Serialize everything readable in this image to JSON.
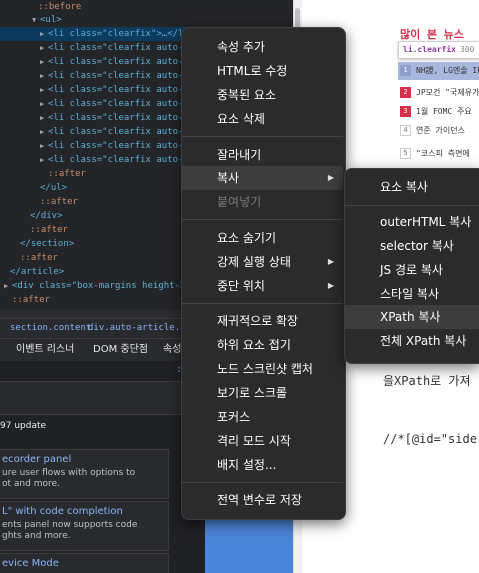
{
  "elements_panel": {
    "lines": [
      {
        "kind": "pseudo",
        "text": "::before"
      },
      {
        "kind": "tag",
        "text": "<ul>"
      },
      {
        "kind": "li",
        "text": "<li class=\"clearfix\">…</li>"
      },
      {
        "kind": "li",
        "text": "<li class=\"clearfix auto-"
      },
      {
        "kind": "li",
        "text": "<li class=\"clearfix auto-"
      },
      {
        "kind": "li",
        "text": "<li class=\"clearfix auto-"
      },
      {
        "kind": "li",
        "text": "<li class=\"clearfix auto-"
      },
      {
        "kind": "li",
        "text": "<li class=\"clearfix auto-"
      },
      {
        "kind": "li",
        "text": "<li class=\"clearfix auto-"
      },
      {
        "kind": "li",
        "text": "<li class=\"clearfix auto-"
      },
      {
        "kind": "li",
        "text": "<li class=\"clearfix auto-"
      },
      {
        "kind": "li",
        "text": "<li class=\"clearfix auto-"
      },
      {
        "kind": "pseudo",
        "text": "::after"
      },
      {
        "kind": "tag",
        "text": "</ul>"
      },
      {
        "kind": "pseudo",
        "text": "::after"
      },
      {
        "kind": "tag",
        "text": "</div>"
      },
      {
        "kind": "pseudo",
        "text": "::after"
      },
      {
        "kind": "tag",
        "text": "</section>"
      },
      {
        "kind": "pseudo",
        "text": "::after"
      },
      {
        "kind": "tag",
        "text": "</article>"
      },
      {
        "kind": "div",
        "text": "<div class=\"box-margins height-30"
      },
      {
        "kind": "pseudo",
        "text": "::after"
      }
    ]
  },
  "breadcrumb": {
    "item1": "section.content",
    "item2": "div.auto-article.auto-d"
  },
  "subtabs": {
    "event_listeners": "이벤트 리스너",
    "dom_breakpoints": "DOM 중단점",
    "properties": "속성"
  },
  "filter": {
    "hint": ":"
  },
  "drawer": {
    "update_title": "97 update",
    "cards": [
      {
        "title": "ecorder panel",
        "desc1": "ure user flows with options to",
        "desc2": "ot and more."
      },
      {
        "title": "L\" with code completion",
        "desc1": "ents panel now supports code",
        "desc2": "ghts and more."
      },
      {
        "title": "evice Mode",
        "desc1": "",
        "desc2": ""
      }
    ]
  },
  "webpage": {
    "most_viewed": "많이 본 뉴스",
    "tooltip_selector": "li.clearfix",
    "tooltip_size": "300 × 23",
    "news": [
      {
        "rank": "1",
        "title": "NH證, LG엔솔 IPO",
        "style": "red"
      },
      {
        "rank": "2",
        "title": "JP모건 \"국제유가",
        "style": "red"
      },
      {
        "rank": "3",
        "title": "1월 FOMC 주요",
        "style": "red"
      },
      {
        "rank": "4",
        "title": "연준 가이던스",
        "style": "gray"
      },
      {
        "rank": "5",
        "title": "\"코스피 측면에",
        "style": "gray"
      }
    ],
    "text1": "을XPath로 가져",
    "text2": "//*[@id=\"side-"
  },
  "context_menu": {
    "items": [
      {
        "label": "속성 추가"
      },
      {
        "label": "HTML로 수정"
      },
      {
        "label": "중복된 요소"
      },
      {
        "label": "요소 삭제"
      },
      {
        "label": "잘라내기"
      },
      {
        "label": "복사"
      },
      {
        "label": "붙여넣기"
      },
      {
        "label": "요소 숨기기"
      },
      {
        "label": "강제 실행 상태"
      },
      {
        "label": "중단 위치"
      },
      {
        "label": "재귀적으로 확장"
      },
      {
        "label": "하위 요소 접기"
      },
      {
        "label": "노드 스크린샷 캡처"
      },
      {
        "label": "보기로 스크롤"
      },
      {
        "label": "포커스"
      },
      {
        "label": "격리 모드 시작"
      },
      {
        "label": "배지 설정..."
      },
      {
        "label": "전역 변수로 저장"
      }
    ]
  },
  "copy_submenu": {
    "items": [
      {
        "label": "요소 복사"
      },
      {
        "label": "outerHTML 복사"
      },
      {
        "label": "selector 복사"
      },
      {
        "label": "JS 경로 복사"
      },
      {
        "label": "스타일 복사"
      },
      {
        "label": "XPath 복사"
      },
      {
        "label": "전체 XPath 복사"
      }
    ]
  },
  "colors": {
    "accent": "#d6304a",
    "selection": "#0c3b5e",
    "menu_bg": "#2b2b2b"
  }
}
